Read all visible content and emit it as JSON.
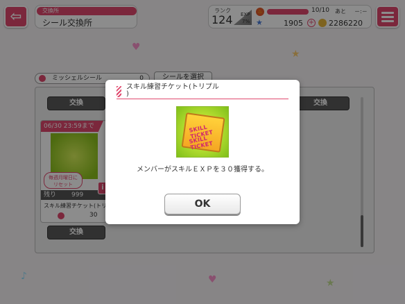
{
  "header": {
    "category": "交換所",
    "title": "シール交換所"
  },
  "status": {
    "rank_label": "ランク",
    "rank_value": "124",
    "exp_label": "EXP",
    "exp_percent": "7%",
    "lp_text": "10/10",
    "lp_until": "あと",
    "lp_time": "－:－",
    "loveca": "1905",
    "gold": "2286220"
  },
  "filter": {
    "sticker_name": "ミッシェルシール",
    "sticker_count": "0",
    "select_button": "シールを選択"
  },
  "list": {
    "exchange_label": "交換",
    "item": {
      "deadline": "06/30 23:59まで",
      "reset_note_line1": "毎週月曜日に",
      "reset_note_line2": "リセット",
      "remaining_label": "残り",
      "remaining_value": "999",
      "name": "スキル練習チケット(トリプル",
      "cost": "30"
    }
  },
  "dialog": {
    "title": "スキル練習チケット(トリプル\n)",
    "ticket_text_1": "SKILL TICKET",
    "ticket_text_2": "SKILL TICKET",
    "description": "メンバーがスキルＥＸＰを３０獲得する。",
    "ok_label": "OK"
  },
  "colors": {
    "accent": "#e0486d",
    "overlay": "rgba(0,0,0,0.45)"
  },
  "icons": {
    "back": "back-arrow-icon",
    "menu": "hamburger-menu-icon",
    "lp": "lp-flame-icon",
    "star": "rank-star-icon",
    "plus": "plus-icon",
    "coin": "gold-coin-icon",
    "stripe": "striped-accent-icon"
  }
}
